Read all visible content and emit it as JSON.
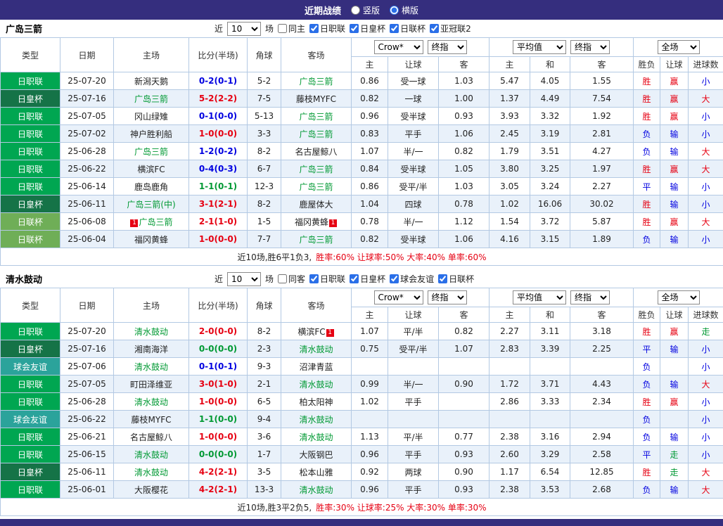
{
  "topbar": {
    "title": "近期战绩",
    "radios": [
      {
        "label": "竖版",
        "checked": false
      },
      {
        "label": "横版",
        "checked": true
      }
    ]
  },
  "controls": {
    "near_label": "近",
    "match_label": "场",
    "odds_company": "Crow*",
    "final_index": "终指",
    "average": "平均值",
    "full_match": "全场"
  },
  "table_header": {
    "type": "类型",
    "date": "日期",
    "home": "主场",
    "score": "比分(半场)",
    "corner": "角球",
    "away": "客场",
    "odd_home": "主",
    "odd_line": "让球",
    "odd_away": "客",
    "avg_home": "主",
    "avg_draw": "和",
    "avg_away": "客",
    "result": "胜负",
    "handicap": "让球",
    "goals": "进球数"
  },
  "type_colors": {
    "日职联": "#00a651",
    "日皇杯": "#157347",
    "日联杯": "#6fae57",
    "球会友谊": "#2ba39b"
  },
  "sections": [
    {
      "team": "广岛三箭",
      "filters": {
        "count": "10",
        "same": "同主",
        "same_checked": false,
        "leagues": [
          {
            "label": "日职联",
            "checked": true
          },
          {
            "label": "日皇杯",
            "checked": true
          },
          {
            "label": "日联杯",
            "checked": true
          },
          {
            "label": "亚冠联2",
            "checked": true
          }
        ]
      },
      "rows": [
        {
          "type": "日职联",
          "date": "25-07-20",
          "home": "新潟天鹅",
          "home_is_team": false,
          "home_badge": "",
          "score": "0-2(0-1)",
          "score_r": "away",
          "corner": "5-2",
          "away": "广岛三箭",
          "away_is_team": true,
          "away_badge": "",
          "oh": "0.86",
          "line": "受一球",
          "oa": "1.03",
          "ah": "5.47",
          "ad": "4.05",
          "aa": "1.55",
          "r1": "胜",
          "r2": "赢",
          "r3": "小"
        },
        {
          "type": "日皇杯",
          "date": "25-07-16",
          "home": "广岛三箭",
          "home_is_team": true,
          "home_badge": "",
          "score": "5-2(2-2)",
          "score_r": "home",
          "corner": "7-5",
          "away": "藤枝MYFC",
          "away_is_team": false,
          "away_badge": "",
          "oh": "0.82",
          "line": "一球",
          "oa": "1.00",
          "ah": "1.37",
          "ad": "4.49",
          "aa": "7.54",
          "r1": "胜",
          "r2": "赢",
          "r3": "大"
        },
        {
          "type": "日职联",
          "date": "25-07-05",
          "home": "冈山绿雉",
          "home_is_team": false,
          "home_badge": "",
          "score": "0-1(0-0)",
          "score_r": "away",
          "corner": "5-13",
          "away": "广岛三箭",
          "away_is_team": true,
          "away_badge": "",
          "oh": "0.96",
          "line": "受半球",
          "oa": "0.93",
          "ah": "3.93",
          "ad": "3.32",
          "aa": "1.92",
          "r1": "胜",
          "r2": "赢",
          "r3": "小"
        },
        {
          "type": "日职联",
          "date": "25-07-02",
          "home": "神户胜利船",
          "home_is_team": false,
          "home_badge": "",
          "score": "1-0(0-0)",
          "score_r": "home",
          "corner": "3-3",
          "away": "广岛三箭",
          "away_is_team": true,
          "away_badge": "",
          "oh": "0.83",
          "line": "平手",
          "oa": "1.06",
          "ah": "2.45",
          "ad": "3.19",
          "aa": "2.81",
          "r1": "负",
          "r2": "输",
          "r3": "小"
        },
        {
          "type": "日职联",
          "date": "25-06-28",
          "home": "广岛三箭",
          "home_is_team": true,
          "home_badge": "",
          "score": "1-2(0-2)",
          "score_r": "away",
          "corner": "8-2",
          "away": "名古屋鲸八",
          "away_is_team": false,
          "away_badge": "",
          "oh": "1.07",
          "line": "半/一",
          "oa": "0.82",
          "ah": "1.79",
          "ad": "3.51",
          "aa": "4.27",
          "r1": "负",
          "r2": "输",
          "r3": "大"
        },
        {
          "type": "日职联",
          "date": "25-06-22",
          "home": "横滨FC",
          "home_is_team": false,
          "home_badge": "",
          "score": "0-4(0-3)",
          "score_r": "away",
          "corner": "6-7",
          "away": "广岛三箭",
          "away_is_team": true,
          "away_badge": "",
          "oh": "0.84",
          "line": "受半球",
          "oa": "1.05",
          "ah": "3.80",
          "ad": "3.25",
          "aa": "1.97",
          "r1": "胜",
          "r2": "赢",
          "r3": "大"
        },
        {
          "type": "日职联",
          "date": "25-06-14",
          "home": "鹿岛鹿角",
          "home_is_team": false,
          "home_badge": "",
          "score": "1-1(0-1)",
          "score_r": "draw",
          "corner": "12-3",
          "away": "广岛三箭",
          "away_is_team": true,
          "away_badge": "",
          "oh": "0.86",
          "line": "受平/半",
          "oa": "1.03",
          "ah": "3.05",
          "ad": "3.24",
          "aa": "2.27",
          "r1": "平",
          "r2": "输",
          "r3": "小"
        },
        {
          "type": "日皇杯",
          "date": "25-06-11",
          "home": "广岛三箭(中)",
          "home_is_team": true,
          "home_badge": "",
          "score": "3-1(2-1)",
          "score_r": "home",
          "corner": "8-2",
          "away": "鹿屋体大",
          "away_is_team": false,
          "away_badge": "",
          "oh": "1.04",
          "line": "四球",
          "oa": "0.78",
          "ah": "1.02",
          "ad": "16.06",
          "aa": "30.02",
          "r1": "胜",
          "r2": "输",
          "r3": "小"
        },
        {
          "type": "日联杯",
          "date": "25-06-08",
          "home": "广岛三箭",
          "home_is_team": true,
          "home_badge": "1",
          "score": "2-1(1-0)",
          "score_r": "home",
          "corner": "1-5",
          "away": "福冈黄蜂",
          "away_is_team": false,
          "away_badge": "1",
          "oh": "0.78",
          "line": "半/一",
          "oa": "1.12",
          "ah": "1.54",
          "ad": "3.72",
          "aa": "5.87",
          "r1": "胜",
          "r2": "赢",
          "r3": "大"
        },
        {
          "type": "日联杯",
          "date": "25-06-04",
          "home": "福冈黄蜂",
          "home_is_team": false,
          "home_badge": "",
          "score": "1-0(0-0)",
          "score_r": "home",
          "corner": "7-7",
          "away": "广岛三箭",
          "away_is_team": true,
          "away_badge": "",
          "oh": "0.82",
          "line": "受半球",
          "oa": "1.06",
          "ah": "4.16",
          "ad": "3.15",
          "aa": "1.89",
          "r1": "负",
          "r2": "输",
          "r3": "小"
        }
      ],
      "summary_lead": "近10场,胜6平1负3,",
      "summary_stats": "胜率:60% 让球率:50% 大率:40% 单率:60%"
    },
    {
      "team": "清水鼓动",
      "filters": {
        "count": "10",
        "same": "同客",
        "same_checked": false,
        "leagues": [
          {
            "label": "日职联",
            "checked": true
          },
          {
            "label": "日皇杯",
            "checked": true
          },
          {
            "label": "球会友谊",
            "checked": true
          },
          {
            "label": "日联杯",
            "checked": true
          }
        ]
      },
      "rows": [
        {
          "type": "日职联",
          "date": "25-07-20",
          "home": "清水鼓动",
          "home_is_team": true,
          "home_badge": "",
          "score": "2-0(0-0)",
          "score_r": "home",
          "corner": "8-2",
          "away": "横滨FC",
          "away_is_team": false,
          "away_badge": "1",
          "oh": "1.07",
          "line": "平/半",
          "oa": "0.82",
          "ah": "2.27",
          "ad": "3.11",
          "aa": "3.18",
          "r1": "胜",
          "r2": "赢",
          "r3": "走"
        },
        {
          "type": "日皇杯",
          "date": "25-07-16",
          "home": "湘南海洋",
          "home_is_team": false,
          "home_badge": "",
          "score": "0-0(0-0)",
          "score_r": "draw",
          "corner": "2-3",
          "away": "清水鼓动",
          "away_is_team": true,
          "away_badge": "",
          "oh": "0.75",
          "line": "受平/半",
          "oa": "1.07",
          "ah": "2.83",
          "ad": "3.39",
          "aa": "2.25",
          "r1": "平",
          "r2": "输",
          "r3": "小"
        },
        {
          "type": "球会友谊",
          "date": "25-07-06",
          "home": "清水鼓动",
          "home_is_team": true,
          "home_badge": "",
          "score": "0-1(0-1)",
          "score_r": "away",
          "corner": "9-3",
          "away": "沼津青蓝",
          "away_is_team": false,
          "away_badge": "",
          "oh": "",
          "line": "",
          "oa": "",
          "ah": "",
          "ad": "",
          "aa": "",
          "r1": "负",
          "r2": "",
          "r3": "小"
        },
        {
          "type": "日职联",
          "date": "25-07-05",
          "home": "町田泽维亚",
          "home_is_team": false,
          "home_badge": "",
          "score": "3-0(1-0)",
          "score_r": "home",
          "corner": "2-1",
          "away": "清水鼓动",
          "away_is_team": true,
          "away_badge": "",
          "oh": "0.99",
          "line": "半/一",
          "oa": "0.90",
          "ah": "1.72",
          "ad": "3.71",
          "aa": "4.43",
          "r1": "负",
          "r2": "输",
          "r3": "大"
        },
        {
          "type": "日职联",
          "date": "25-06-28",
          "home": "清水鼓动",
          "home_is_team": true,
          "home_badge": "",
          "score": "1-0(0-0)",
          "score_r": "home",
          "corner": "6-5",
          "away": "柏太阳神",
          "away_is_team": false,
          "away_badge": "",
          "oh": "1.02",
          "line": "平手",
          "oa": "",
          "ah": "2.86",
          "ad": "3.33",
          "aa": "2.34",
          "r1": "胜",
          "r2": "赢",
          "r3": "小"
        },
        {
          "type": "球会友谊",
          "date": "25-06-22",
          "home": "藤枝MYFC",
          "home_is_team": false,
          "home_badge": "",
          "score": "1-1(0-0)",
          "score_r": "draw",
          "corner": "9-4",
          "away": "清水鼓动",
          "away_is_team": true,
          "away_badge": "",
          "oh": "",
          "line": "",
          "oa": "",
          "ah": "",
          "ad": "",
          "aa": "",
          "r1": "负",
          "r2": "",
          "r3": "小"
        },
        {
          "type": "日职联",
          "date": "25-06-21",
          "home": "名古屋鲸八",
          "home_is_team": false,
          "home_badge": "",
          "score": "1-0(0-0)",
          "score_r": "home",
          "corner": "3-6",
          "away": "清水鼓动",
          "away_is_team": true,
          "away_badge": "",
          "oh": "1.13",
          "line": "平/半",
          "oa": "0.77",
          "ah": "2.38",
          "ad": "3.16",
          "aa": "2.94",
          "r1": "负",
          "r2": "输",
          "r3": "小"
        },
        {
          "type": "日职联",
          "date": "25-06-15",
          "home": "清水鼓动",
          "home_is_team": true,
          "home_badge": "",
          "score": "0-0(0-0)",
          "score_r": "draw",
          "corner": "1-7",
          "away": "大阪钢巴",
          "away_is_team": false,
          "away_badge": "",
          "oh": "0.96",
          "line": "平手",
          "oa": "0.93",
          "ah": "2.60",
          "ad": "3.29",
          "aa": "2.58",
          "r1": "平",
          "r2": "走",
          "r3": "小"
        },
        {
          "type": "日皇杯",
          "date": "25-06-11",
          "home": "清水鼓动",
          "home_is_team": true,
          "home_badge": "",
          "score": "4-2(2-1)",
          "score_r": "home",
          "corner": "3-5",
          "away": "松本山雅",
          "away_is_team": false,
          "away_badge": "",
          "oh": "0.92",
          "line": "两球",
          "oa": "0.90",
          "ah": "1.17",
          "ad": "6.54",
          "aa": "12.85",
          "r1": "胜",
          "r2": "走",
          "r3": "大"
        },
        {
          "type": "日职联",
          "date": "25-06-01",
          "home": "大阪樱花",
          "home_is_team": false,
          "home_badge": "",
          "score": "4-2(2-1)",
          "score_r": "home",
          "corner": "13-3",
          "away": "清水鼓动",
          "away_is_team": true,
          "away_badge": "",
          "oh": "0.96",
          "line": "平手",
          "oa": "0.93",
          "ah": "2.38",
          "ad": "3.53",
          "aa": "2.68",
          "r1": "负",
          "r2": "输",
          "r3": "大"
        }
      ],
      "summary_lead": "近10场,胜3平2负5,",
      "summary_stats": "胜率:30% 让球率:25% 大率:30% 单率:30%"
    }
  ]
}
